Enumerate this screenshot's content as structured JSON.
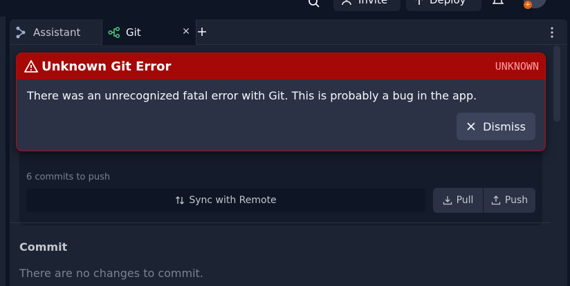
{
  "topbar": {
    "search_icon": "search-icon",
    "invite_label": "Invite",
    "deploy_label": "Deploy",
    "bell_icon": "bell-icon",
    "avatar_badge": "+"
  },
  "tabs": [
    {
      "label": "Assistant",
      "icon": "assistant-icon",
      "active": false
    },
    {
      "label": "Git",
      "icon": "git-icon",
      "active": true,
      "closable": true
    }
  ],
  "git": {
    "commits_to_push": "6 commits to push",
    "sync_label": "Sync with Remote",
    "pull_label": "Pull",
    "push_label": "Push",
    "commit_heading": "Commit",
    "no_changes": "There are no changes to commit."
  },
  "error": {
    "title": "Unknown Git Error",
    "code": "UNKNOWN",
    "message": "There was an unrecognized fatal error with Git. This is probably a bug in the app.",
    "dismiss_label": "Dismiss"
  },
  "colors": {
    "background": "#0e1525",
    "panel": "#1c2333",
    "error_header": "#a60808",
    "error_border": "#b80c0c",
    "error_code": "#ff9d9d",
    "git_accent": "#4fd07c"
  }
}
